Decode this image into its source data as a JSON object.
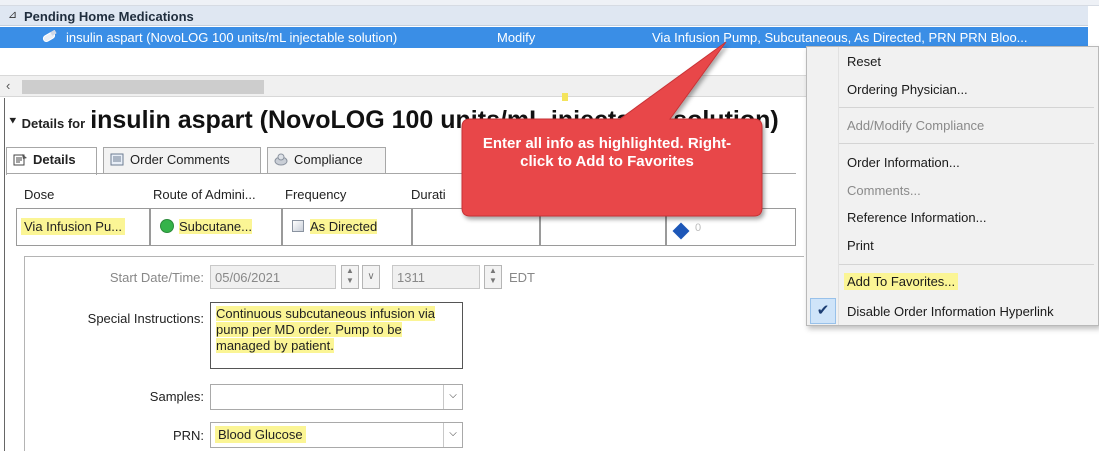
{
  "pending": {
    "section_title": "Pending Home Medications",
    "med_name": "insulin aspart (NovoLOG 100 units/mL injectable solution)",
    "med_action": "Modify",
    "med_detail": "Via Infusion Pump, Subcutaneous, As Directed, PRN PRN Bloo..."
  },
  "details": {
    "prefix": "Details for",
    "name": "insulin aspart (NovoLOG 100 units/mL injectable solution)"
  },
  "tabs": [
    {
      "label": "Details"
    },
    {
      "label": "Order Comments"
    },
    {
      "label": "Compliance"
    }
  ],
  "grid": {
    "headers": [
      "Dose",
      "Route of Admini...",
      "Frequency",
      "Durati"
    ],
    "dose": "Via Infusion Pu...",
    "route": "Subcutane...",
    "frequency": "As Directed",
    "diamond_count": "0"
  },
  "form": {
    "start_label": "Start Date/Time:",
    "start_date": "05/06/2021",
    "start_time": "1311",
    "timezone": "EDT",
    "special_label": "Special Instructions:",
    "special_text": "Continuous subcutaneous infusion via pump per MD order.  Pump to be managed by patient.",
    "samples_label": "Samples:",
    "samples_value": "",
    "prn_label": "PRN:",
    "prn_value": "Blood Glucose"
  },
  "callout": {
    "text": "Enter all info as highlighted.  Right-click to Add to Favorites",
    "color": "#e8474a"
  },
  "context_menu": {
    "items": [
      {
        "label": "Reset",
        "enabled": true
      },
      {
        "label": "Ordering Physician...",
        "enabled": true
      },
      {
        "label": "Add/Modify Compliance",
        "enabled": false
      },
      {
        "label": "Order Information...",
        "enabled": true
      },
      {
        "label": "Comments...",
        "enabled": false
      },
      {
        "label": "Reference Information...",
        "enabled": true
      },
      {
        "label": "Print",
        "enabled": true
      },
      {
        "label": "Add To Favorites...",
        "enabled": true,
        "highlighted": true
      },
      {
        "label": "Disable Order Information Hyperlink",
        "enabled": true,
        "checked": true
      }
    ]
  },
  "colors": {
    "highlight": "#fbf595",
    "selection": "#3a8ee6",
    "callout": "#e8474a"
  }
}
